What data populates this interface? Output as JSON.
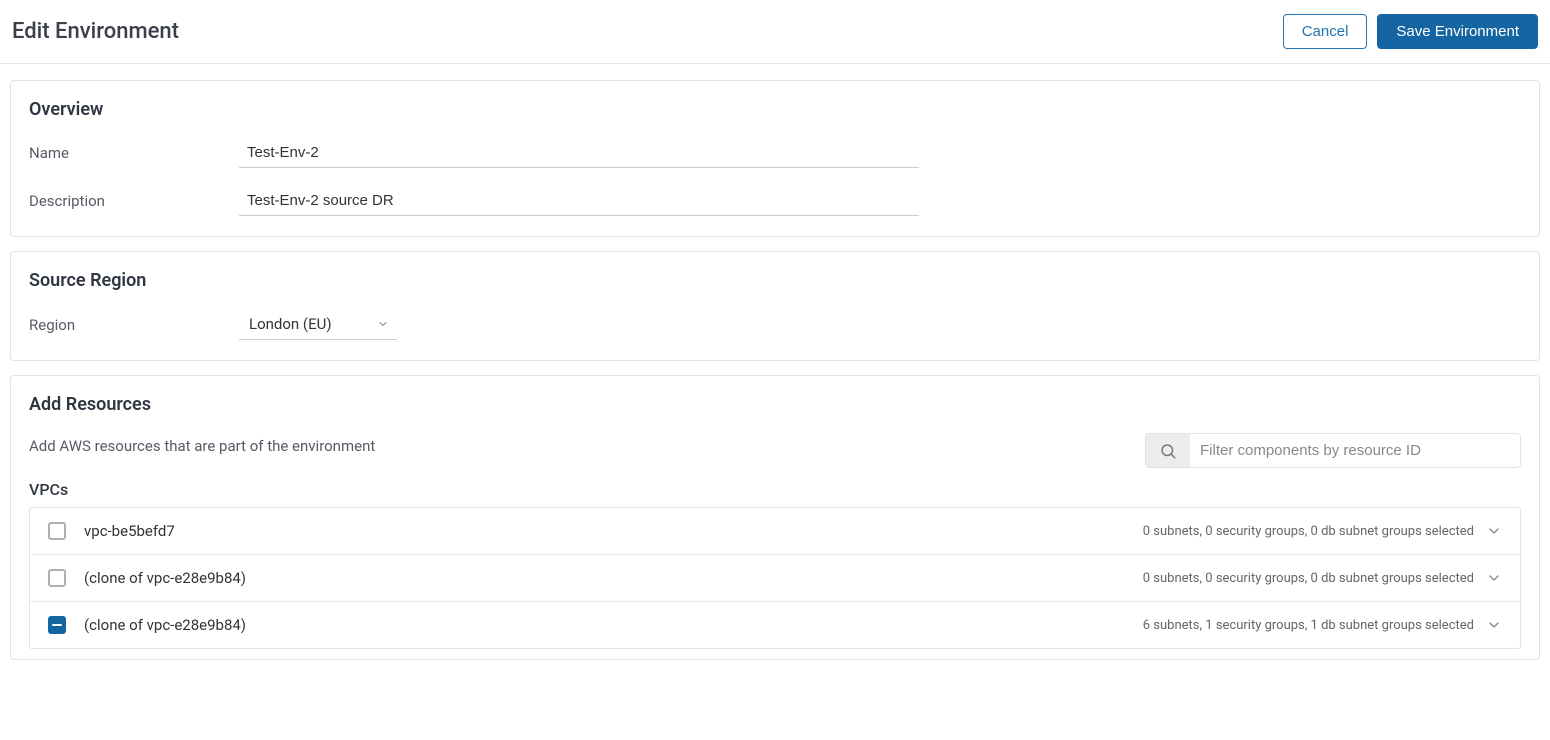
{
  "header": {
    "title": "Edit Environment",
    "cancel_label": "Cancel",
    "save_label": "Save Environment"
  },
  "overview": {
    "title": "Overview",
    "name_label": "Name",
    "name_value": "Test-Env-2",
    "description_label": "Description",
    "description_value": "Test-Env-2 source DR"
  },
  "source_region": {
    "title": "Source Region",
    "region_label": "Region",
    "region_value": "London (EU)"
  },
  "resources": {
    "title": "Add Resources",
    "helper": "Add AWS resources that are part of the environment",
    "search_placeholder": "Filter components by resource ID",
    "vpcs_title": "VPCs",
    "vpcs": [
      {
        "name": "vpc-be5befd7",
        "summary": "0 subnets, 0 security groups, 0 db subnet groups selected",
        "state": "unchecked"
      },
      {
        "name": "(clone of vpc-e28e9b84)",
        "summary": "0 subnets, 0 security groups, 0 db subnet groups selected",
        "state": "unchecked"
      },
      {
        "name": "(clone of vpc-e28e9b84)",
        "summary": "6 subnets, 1 security groups, 1 db subnet groups selected",
        "state": "indeterminate"
      }
    ]
  }
}
